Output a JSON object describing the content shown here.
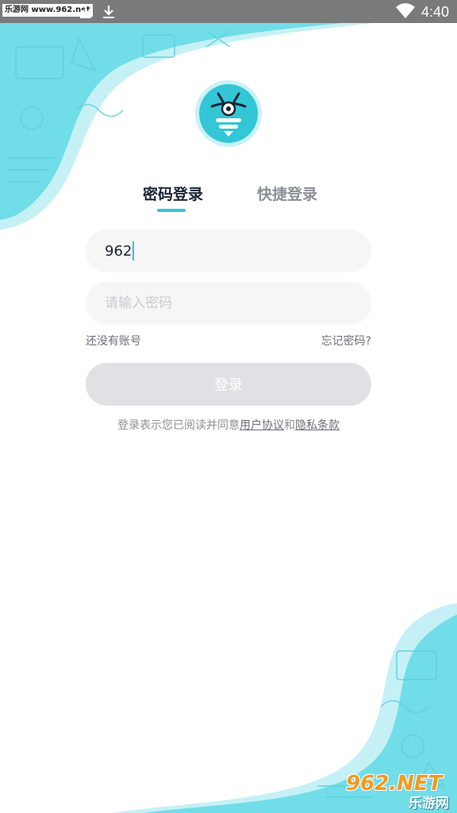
{
  "status_bar": {
    "watermark": "乐游网 www.962.net",
    "time": "4:40"
  },
  "colors": {
    "accent": "#33c6d6",
    "wave_light": "#bfeff4",
    "wave_main": "#6fdde8",
    "button_disabled": "#e1e1e5"
  },
  "tabs": {
    "password_login": "密码登录",
    "quick_login": "快捷登录",
    "active": "password_login"
  },
  "form": {
    "account_value": "962",
    "password_placeholder": "请输入密码",
    "register_link": "还没有账号",
    "forgot_link": "忘记密码?",
    "login_button": "登录"
  },
  "agreement": {
    "prefix": "登录表示您已阅读并同意",
    "user_agreement": "用户协议",
    "and": "和",
    "privacy_policy": "隐私条款"
  },
  "site_badge": {
    "top": "962.NET",
    "bottom": "乐游网"
  },
  "icons": [
    "notification-icon",
    "download-icon",
    "wifi-icon",
    "bee-logo-icon"
  ]
}
